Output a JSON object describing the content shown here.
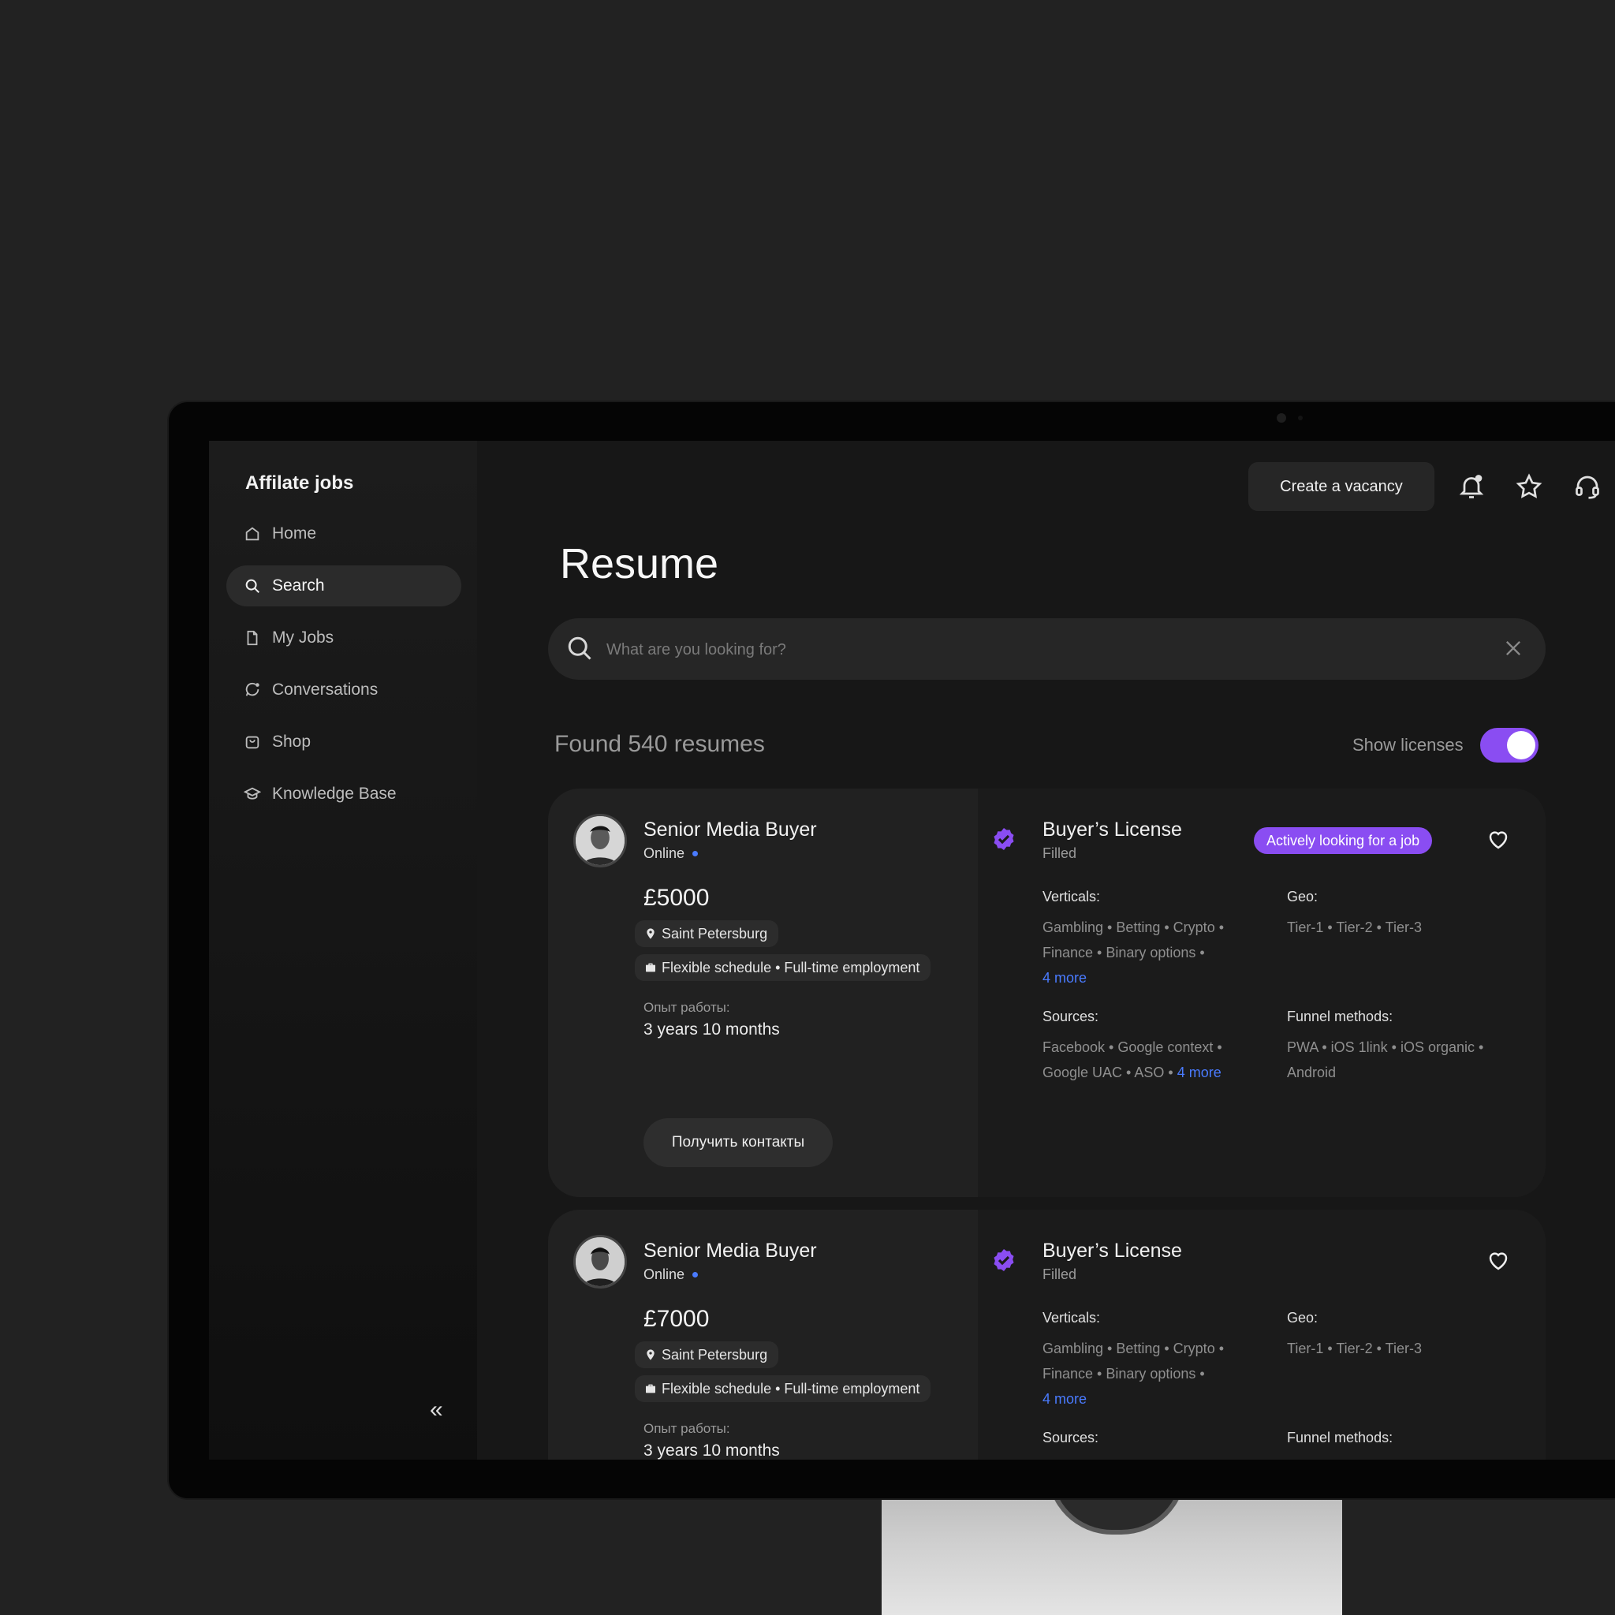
{
  "app": {
    "title": "Affilate jobs"
  },
  "sidebar": {
    "items": [
      {
        "label": "Home",
        "icon": "home-icon"
      },
      {
        "label": "Search",
        "icon": "search-icon",
        "active": true
      },
      {
        "label": "My Jobs",
        "icon": "file-icon"
      },
      {
        "label": "Conversations",
        "icon": "chat-icon"
      },
      {
        "label": "Shop",
        "icon": "bag-icon"
      },
      {
        "label": "Knowledge Base",
        "icon": "graduation-cap-icon"
      }
    ],
    "collapse_label": "«"
  },
  "header": {
    "create_label": "Create a vacancy",
    "icons": [
      "bell-icon",
      "star-icon",
      "headset-icon"
    ]
  },
  "main": {
    "title": "Resume",
    "search": {
      "placeholder": "What are you looking for?",
      "value": ""
    },
    "found_label": "Found 540 resumes",
    "show_licenses": {
      "label": "Show licenses",
      "on": true
    }
  },
  "cards": [
    {
      "title": "Senior Media Buyer",
      "status": "Online",
      "salary": "£5000",
      "location": "Saint Petersburg",
      "schedule": "Flexible schedule • Full-time employment",
      "exp_label": "Опыт работы:",
      "exp_value": "3 years 10 months",
      "contacts_label": "Получить контакты",
      "license_title": "Buyer’s License",
      "license_status": "Filled",
      "badge": "Actively looking for a job",
      "verticals_label": "Verticals:",
      "verticals": "Gambling • Betting • Crypto • Finance • Binary options •",
      "verticals_more": "4 more",
      "geo_label": "Geo:",
      "geo": "Tier-1 • Tier-2 • Tier-3",
      "sources_label": "Sources:",
      "sources": "Facebook • Google context • Google UAC • ASO •",
      "sources_more": "4 more",
      "funnel_label": "Funnel methods:",
      "funnel": "PWA • iOS 1link • iOS organic • Android"
    },
    {
      "title": "Senior Media Buyer",
      "status": "Online",
      "salary": "£7000",
      "location": "Saint Petersburg",
      "schedule": "Flexible schedule • Full-time employment",
      "exp_label": "Опыт работы:",
      "exp_value": "3 years 10 months",
      "license_title": "Buyer’s License",
      "license_status": "Filled",
      "verticals_label": "Verticals:",
      "verticals": "Gambling • Betting • Crypto • Finance • Binary options •",
      "verticals_more": "4 more",
      "geo_label": "Geo:",
      "geo": "Tier-1 • Tier-2 • Tier-3",
      "sources_label": "Sources:",
      "funnel_label": "Funnel methods:"
    }
  ],
  "colors": {
    "accent": "#8a4df2",
    "link": "#4a7bff",
    "background": "#171717"
  }
}
